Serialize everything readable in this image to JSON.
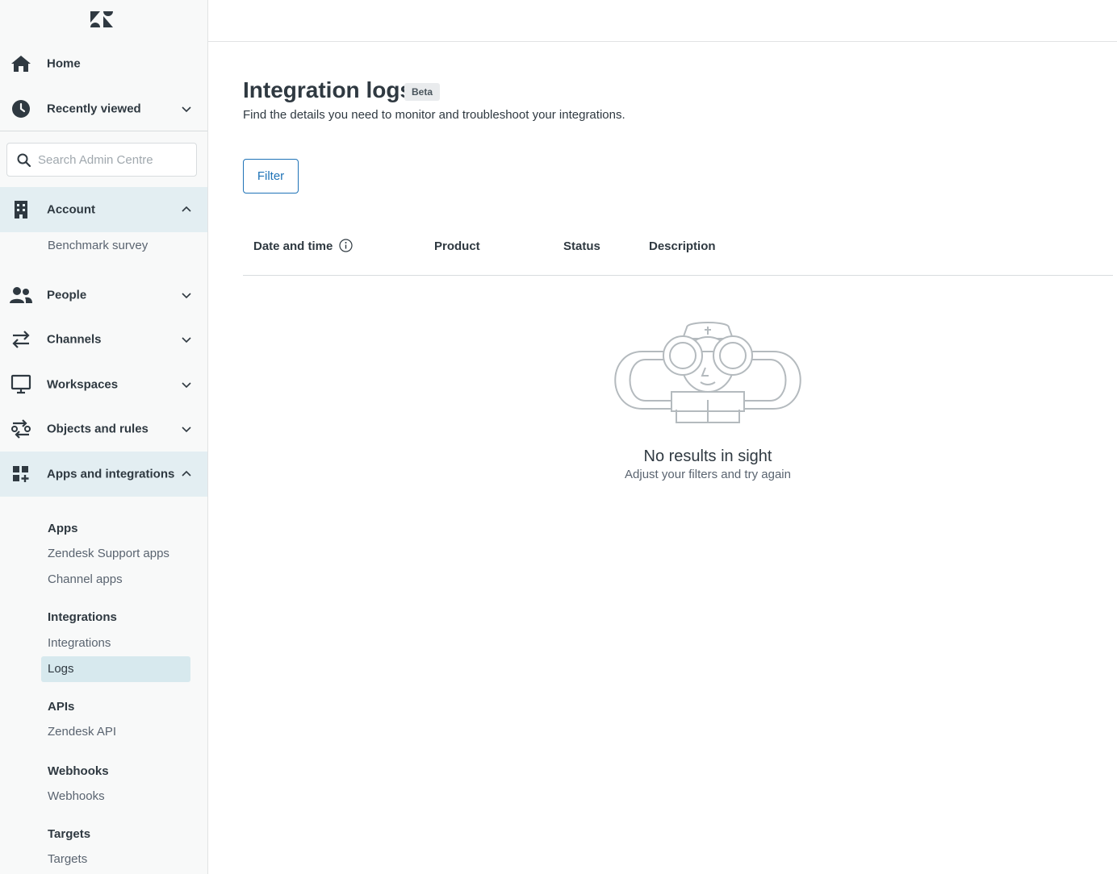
{
  "sidebar": {
    "logo": "zendesk-logo",
    "home": "Home",
    "recently_viewed": "Recently viewed",
    "search_placeholder": "Search Admin Centre",
    "account": {
      "label": "Account",
      "children": [
        "Benchmark survey"
      ]
    },
    "people": "People",
    "channels": "Channels",
    "workspaces": "Workspaces",
    "objects_rules": "Objects and rules",
    "apps_integrations": {
      "label": "Apps and integrations",
      "groups": [
        {
          "heading": "Apps",
          "links": [
            "Zendesk Support apps",
            "Channel apps"
          ]
        },
        {
          "heading": "Integrations",
          "links": [
            "Integrations",
            "Logs"
          ]
        },
        {
          "heading": "APIs",
          "links": [
            "Zendesk API"
          ]
        },
        {
          "heading": "Webhooks",
          "links": [
            "Webhooks"
          ]
        },
        {
          "heading": "Targets",
          "links": [
            "Targets"
          ]
        }
      ],
      "selected": "Logs"
    }
  },
  "main": {
    "title": "Integration logs",
    "badge": "Beta",
    "subtitle": "Find the details you need to monitor and troubleshoot your integrations.",
    "filter_label": "Filter",
    "columns": [
      "Date and time",
      "Product",
      "Status",
      "Description"
    ],
    "empty": {
      "title": "No results in sight",
      "subtitle": "Adjust your filters and try again"
    }
  },
  "colors": {
    "accent": "#1f73b7",
    "sidebar_bg": "#f8f9f9",
    "active_bg": "#e3eef2",
    "selected_bg": "#d7e9ee"
  }
}
